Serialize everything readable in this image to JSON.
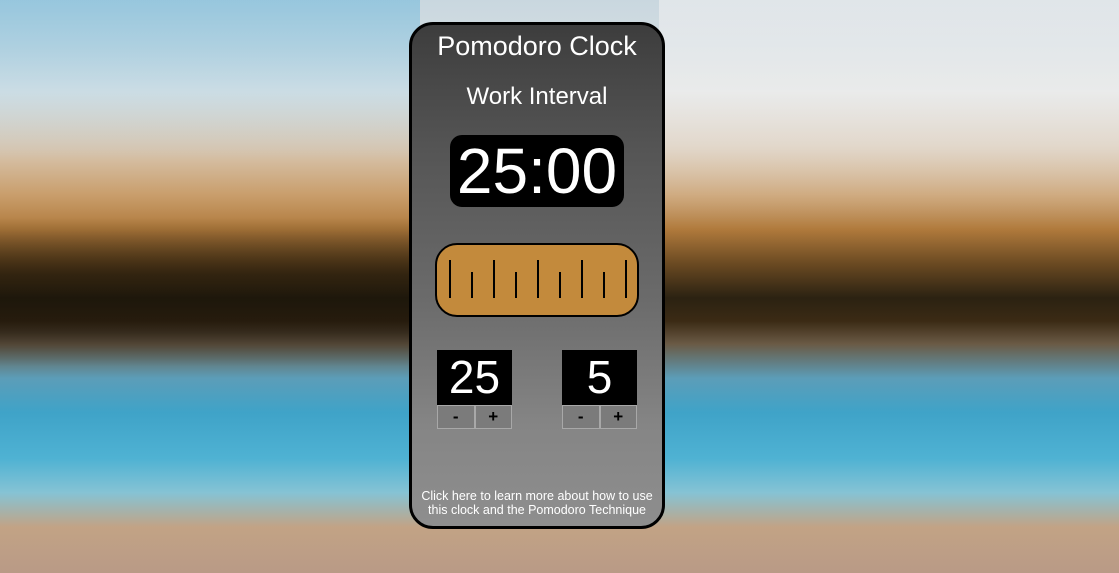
{
  "app": {
    "title": "Pomodoro Clock",
    "interval_label": "Work Interval",
    "timer_display": "25:00"
  },
  "settings": {
    "work_minutes": "25",
    "break_minutes": "5",
    "decrement_label": "-",
    "increment_label": "+"
  },
  "info_link_text": "Click here to learn more about how to use this clock and the Pomodoro Technique",
  "colors": {
    "ruler_fill": "#c38a3c",
    "display_background": "#000000",
    "text": "#ffffff"
  }
}
